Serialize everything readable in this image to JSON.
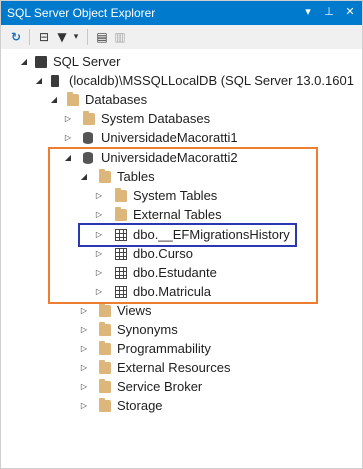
{
  "window": {
    "title": "SQL Server Object Explorer",
    "buttons": [
      "▾",
      "⊥",
      "✕"
    ]
  },
  "toolbar": {
    "refresh": "↻",
    "collapse": "⊟",
    "filter": "▼",
    "filter_more": "▾",
    "new_query": "▤",
    "disconnect": "▥"
  },
  "tree": {
    "root": "SQL Server",
    "server": "(localdb)\\MSSQLLocalDB (SQL Server 13.0.1601",
    "databases": "Databases",
    "system_databases": "System Databases",
    "db1": "UniversidadeMacoratti1",
    "db2": "UniversidadeMacoratti2",
    "tables": "Tables",
    "system_tables": "System Tables",
    "external_tables": "External Tables",
    "t_migrations": "dbo.__EFMigrationsHistory",
    "t_curso": "dbo.Curso",
    "t_estudante": "dbo.Estudante",
    "t_matricula": "dbo.Matricula",
    "views": "Views",
    "synonyms": "Synonyms",
    "programmability": "Programmability",
    "external_resources": "External Resources",
    "service_broker": "Service Broker",
    "storage": "Storage"
  },
  "colors": {
    "titlebar": "#007acc",
    "highlight_orange": "#ed7d31",
    "highlight_blue": "#2b36b2"
  }
}
